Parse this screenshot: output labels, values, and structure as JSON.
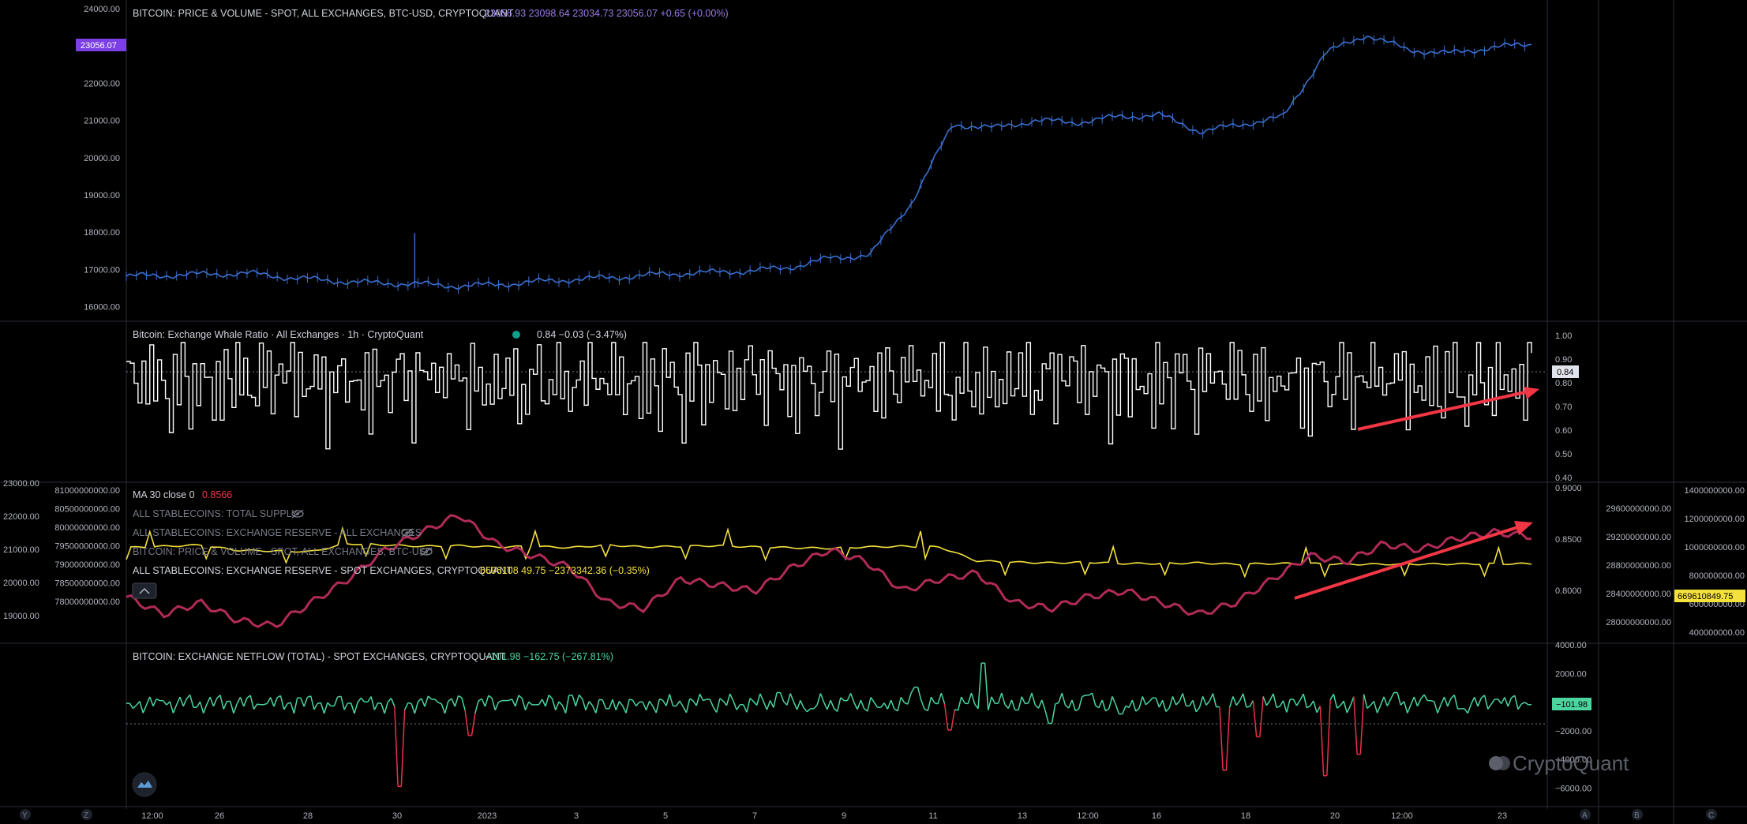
{
  "colors": {
    "background": "#000000",
    "grid": "#2a2e39",
    "price": "#3a6fd0",
    "price_badge": "#7b3fe4",
    "whale": "#ffffff",
    "ma": "#b02a5a",
    "reserve": "#f5e13c",
    "netflow_pos": "#4bd6a0",
    "netflow_neg": "#e8314a",
    "arrow": "#f23645",
    "legend_values_price": "#9b7be6",
    "legend_values_reserve": "#f5e13c",
    "legend_values_netflow": "#4bd6a0",
    "legend_values_ma": "#f23645"
  },
  "panes": {
    "price": {
      "legend_title": "BITCOIN: PRICE & VOLUME - SPOT, ALL EXCHANGES, BTC-USD, CRYPTOQUANT",
      "legend_values": "23056.93  23098.64  23034.73  23056.07  +0.65 (+0.00%)",
      "badge": "23056.07",
      "ticks": [
        "24000.00",
        "23000.00",
        "22000.00",
        "21000.00",
        "20000.00",
        "19000.00",
        "18000.00",
        "17000.00",
        "16000.00"
      ]
    },
    "whale": {
      "legend_title": "Bitcoin: Exchange Whale Ratio · All Exchanges · 1h · CryptoQuant",
      "legend_values": "0.84  −0.03 (−3.47%)",
      "badge": "0.84",
      "ticks": [
        "1.00",
        "0.90",
        "0.80",
        "0.70",
        "0.60",
        "0.50",
        "0.40"
      ]
    },
    "stable": {
      "legend_ma_title": "MA 30 close 0",
      "legend_ma_value": "0.8566",
      "legend_hidden_1": "ALL STABLECOINS: TOTAL SUPPLY",
      "legend_hidden_2": "ALL STABLECOINS: EXCHANGE RESERVE - ALL EXCHANGES",
      "legend_hidden_3": "BITCOIN: PRICE & VOLUME - SPOT, ALL EXCHANGES, BTC-USD",
      "legend_reserve_title": "ALL STABLECOINS: EXCHANGE RESERVE - SPOT EXCHANGES, CRYPTOQUANT",
      "legend_reserve_values": "6696108 49.75  −2373342.36 (−0.35%)",
      "collapse_icon": "chevron-up-icon",
      "reserve_badge": "669610849.75",
      "ticks_far_left": [
        "23000.00",
        "22000.00",
        "21000.00",
        "20000.00",
        "19000.00"
      ],
      "ticks_left": [
        "81000000000.00",
        "80500000000.00",
        "80000000000.00",
        "79500000000.00",
        "79000000000.00",
        "78500000000.00",
        "78000000000.00"
      ],
      "ticks_right1": [
        "0.9000",
        "0.8500",
        "0.8000"
      ],
      "ticks_right2": [
        "29600000000.00",
        "29200000000.00",
        "28800000000.00",
        "28400000000.00",
        "28000000000.00"
      ],
      "ticks_right3": [
        "1400000000.00",
        "1200000000.00",
        "1000000000.00",
        "800000000.00",
        "600000000.00",
        "400000000.00"
      ]
    },
    "netflow": {
      "legend_title": "BITCOIN: EXCHANGE NETFLOW (TOTAL) - SPOT EXCHANGES, CRYPTOQUANT",
      "legend_values": "−101.98  −162.75 (−267.81%)",
      "badge": "−101.98",
      "ticks": [
        "4000.00",
        "2000.00",
        "0.00",
        "−2000.00",
        "−4000.00",
        "−6000.00"
      ]
    }
  },
  "xaxis": {
    "ticks": [
      "12:00",
      "26",
      "28",
      "30",
      "2023",
      "3",
      "5",
      "7",
      "9",
      "11",
      "13",
      "12:00",
      "16",
      "18",
      "20",
      "12:00",
      "23"
    ],
    "corner_left": [
      "Y",
      "Z"
    ],
    "corner_right": [
      "A",
      "B",
      "C"
    ]
  },
  "watermark": "CryptoQuant",
  "logo_icon": "cryptoquant-logo-icon",
  "chart_data": [
    {
      "type": "line",
      "title": "BITCOIN: PRICE & VOLUME - SPOT, ALL EXCHANGES, BTC-USD, CRYPTOQUANT",
      "ylim": [
        15700,
        24000
      ],
      "x_range_days": [
        "2022-12-24 12:00",
        "2023-01-24 06:00"
      ],
      "series": [
        {
          "name": "BTC-USD",
          "values": [
            16820,
            16850,
            16880,
            16900,
            16780,
            16700,
            16640,
            16620,
            16560,
            16600,
            16680,
            16750,
            16800,
            16880,
            16920,
            16960,
            17050,
            17300,
            17400,
            18800,
            20900,
            20800,
            21000,
            20950,
            21100,
            21150,
            20700,
            20900,
            21100,
            22800,
            23300,
            22900,
            22800,
            22950,
            23056
          ]
        }
      ],
      "annotations": [
        "single wick spike to ~17980 around Dec 30"
      ]
    },
    {
      "type": "bar",
      "title": "Bitcoin: Exchange Whale Ratio · All Exchanges · 1h · CryptoQuant",
      "ylim": [
        0.4,
        1.0
      ],
      "series": [
        {
          "name": "Whale Ratio",
          "values": [
            0.84,
            0.8,
            0.88,
            0.72,
            0.92,
            0.78,
            0.86,
            0.7,
            0.9,
            0.76,
            0.84,
            0.62,
            0.88,
            0.74,
            0.92,
            0.8,
            0.68,
            0.86,
            0.78,
            0.9,
            0.72,
            0.84,
            0.6,
            0.88,
            0.76,
            0.92,
            0.82,
            0.7,
            0.86,
            0.78,
            0.94,
            0.74,
            0.84,
            0.66,
            0.9,
            0.8,
            0.86,
            0.72,
            0.92,
            0.84
          ]
        }
      ],
      "annotations": [
        "red arrow trending upward from ~0.62 (Jan 20) to ~0.80 (Jan 24)"
      ]
    },
    {
      "type": "line",
      "title": "MA 30 close 0 / ALL STABLECOINS: EXCHANGE RESERVE - SPOT EXCHANGES",
      "series": [
        {
          "name": "MA 30 close 0",
          "axis": "right1",
          "ylim": [
            0.77,
            0.9
          ],
          "values": [
            0.805,
            0.79,
            0.8,
            0.785,
            0.78,
            0.8,
            0.82,
            0.845,
            0.86,
            0.875,
            0.85,
            0.84,
            0.83,
            0.8,
            0.795,
            0.82,
            0.815,
            0.81,
            0.83,
            0.845,
            0.835,
            0.81,
            0.82,
            0.825,
            0.8,
            0.795,
            0.805,
            0.81,
            0.8,
            0.79,
            0.8,
            0.82,
            0.84,
            0.835,
            0.85,
            0.845,
            0.855,
            0.86,
            0.8566
          ]
        },
        {
          "name": "ALL STABLECOINS: EXCHANGE RESERVE - SPOT EXCHANGES",
          "axis": "right3",
          "ylim": [
            300000000,
            1450000000
          ],
          "values": [
            980000000,
            990000000,
            1000000000,
            960000000,
            955000000,
            950000000,
            1010000000,
            1000000000,
            990000000,
            995000000,
            985000000,
            990000000,
            980000000,
            1000000000,
            985000000,
            990000000,
            995000000,
            985000000,
            980000000,
            975000000,
            985000000,
            990000000,
            985000000,
            880000000,
            870000000,
            865000000,
            870000000,
            860000000,
            860000000,
            865000000,
            855000000,
            860000000,
            860000000,
            855000000,
            855000000,
            856000000,
            857000000,
            858000000,
            858000000
          ]
        }
      ],
      "annotations": [
        "red arrow trending upward across Jan 19 → Jan 24"
      ]
    },
    {
      "type": "line",
      "title": "BITCOIN: EXCHANGE NETFLOW (TOTAL) - SPOT EXCHANGES, CRYPTOQUANT",
      "ylim": [
        -7000,
        4300
      ],
      "series": [
        {
          "name": "Netflow",
          "values": [
            0,
            200,
            -300,
            150,
            -100,
            400,
            -200,
            100,
            -6200,
            300,
            -2400,
            200,
            -100,
            600,
            -400,
            100,
            -200,
            300,
            -100,
            800,
            -400,
            200,
            -300,
            1200,
            -2000,
            3000,
            -500,
            -1500,
            600,
            -800,
            400,
            -200,
            -5000,
            -2500,
            300,
            -5400,
            -3800,
            800,
            200,
            -400,
            300,
            -101.98
          ]
        }
      ]
    }
  ]
}
